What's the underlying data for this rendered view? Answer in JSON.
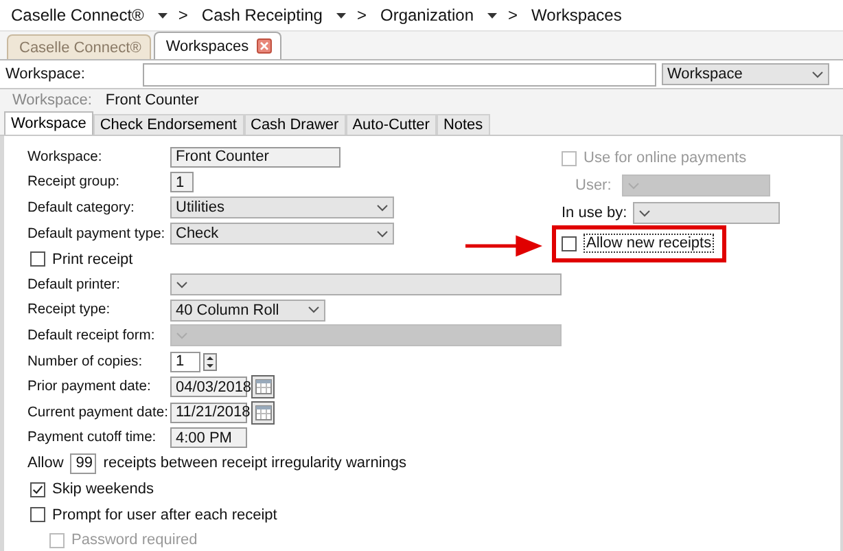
{
  "breadcrumb": [
    {
      "label": "Caselle Connect®",
      "dropdown": true,
      "separator": ">"
    },
    {
      "label": "Cash Receipting",
      "dropdown": true,
      "separator": ">"
    },
    {
      "label": "Organization",
      "dropdown": true,
      "separator": ">"
    },
    {
      "label": "Workspaces",
      "dropdown": false
    }
  ],
  "doc_tabs": [
    {
      "label": "Caselle Connect®",
      "selected": false,
      "closable": false
    },
    {
      "label": "Workspaces",
      "selected": true,
      "closable": true
    }
  ],
  "search": {
    "label": "Workspace:",
    "scope": "Workspace"
  },
  "header": {
    "label": "Workspace:",
    "value": "Front Counter"
  },
  "tabs": [
    {
      "label": "Workspace",
      "selected": true
    },
    {
      "label": "Check Endorsement",
      "selected": false
    },
    {
      "label": "Cash Drawer",
      "selected": false
    },
    {
      "label": "Auto-Cutter",
      "selected": false
    },
    {
      "label": "Notes",
      "selected": false
    }
  ],
  "form": {
    "fields": [
      {
        "kind": "text",
        "label": "Workspace:",
        "value": "Front Counter"
      },
      {
        "kind": "number",
        "label": "Receipt group:",
        "value": "1"
      },
      {
        "kind": "dropdown",
        "label": "Default category:",
        "value": "Utilities",
        "disabled": false
      },
      {
        "kind": "dropdown",
        "label": "Default payment type:",
        "value": "Check",
        "disabled": false
      },
      {
        "kind": "checkbox",
        "label": "Print receipt",
        "checked": false,
        "disabled": false
      },
      {
        "kind": "dropdown",
        "label": "Default printer:",
        "disabled": false
      },
      {
        "kind": "dropdown",
        "label": "Receipt type:",
        "value": "40 Column Roll",
        "disabled": false
      },
      {
        "kind": "dropdown",
        "label": "Default receipt form:",
        "disabled": true
      },
      {
        "kind": "spinner",
        "label": "Number of copies:",
        "value": "1"
      },
      {
        "kind": "date",
        "label": "Prior payment date:",
        "value": "04/03/2018"
      },
      {
        "kind": "date",
        "label": "Current payment date:",
        "value": "11/21/2018"
      },
      {
        "kind": "time",
        "label": "Payment cutoff time:",
        "value": "4:00 PM"
      },
      {
        "kind": "allow",
        "before": "Allow",
        "value": "99",
        "after": "receipts between receipt irregularity warnings"
      },
      {
        "kind": "checkbox",
        "label": "Skip weekends",
        "checked": true,
        "disabled": false
      },
      {
        "kind": "checkbox",
        "label": "Prompt for user after each receipt",
        "checked": false,
        "disabled": false
      },
      {
        "kind": "sub_checkbox",
        "label": "Password required",
        "checked": false,
        "disabled": true
      }
    ],
    "side": [
      {
        "kind": "checkbox",
        "label": "Use for online payments",
        "checked": false,
        "disabled": true,
        "highlighted": false
      },
      {
        "kind": "dropdown",
        "label": "User:",
        "disabled": true,
        "indented": true
      },
      {
        "kind": "dropdown",
        "label": "In use by:",
        "disabled": false,
        "indented": false
      },
      {
        "kind": "checkbox",
        "label": "Allow new receipts",
        "checked": false,
        "disabled": false,
        "highlighted": true
      }
    ]
  }
}
